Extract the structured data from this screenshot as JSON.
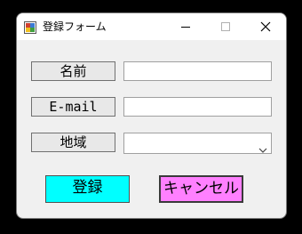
{
  "window": {
    "title": "登録フォーム"
  },
  "form": {
    "name_label": "名前",
    "email_label": "E-mail",
    "region_label": "地域",
    "name_value": "",
    "email_value": "",
    "region_value": ""
  },
  "buttons": {
    "register_label": "登録",
    "cancel_label": "キャンセル"
  },
  "colors": {
    "register_bg": "#00ffff",
    "cancel_bg": "#ff80ff"
  }
}
